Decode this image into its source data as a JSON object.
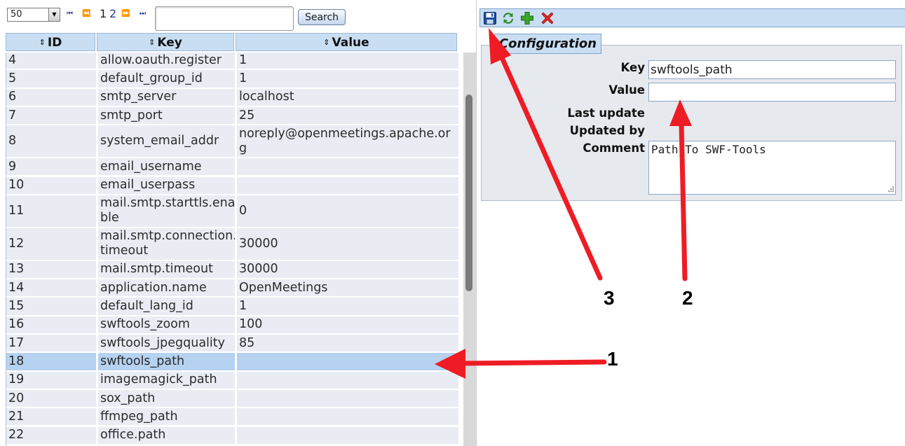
{
  "toolbar": {
    "page_size": "50",
    "nav_first": "⏮",
    "nav_prev": "⏪",
    "pages": [
      "1",
      "2"
    ],
    "nav_next": "⏩",
    "nav_last": "⏭",
    "search_value": "",
    "search_label": "Search"
  },
  "grid": {
    "columns": [
      "ID",
      "Key",
      "Value"
    ],
    "sort_icon": "⇕",
    "rows": [
      {
        "id": "4",
        "key": "allow.oauth.register",
        "value": "1"
      },
      {
        "id": "5",
        "key": "default_group_id",
        "value": "1"
      },
      {
        "id": "6",
        "key": "smtp_server",
        "value": "localhost"
      },
      {
        "id": "7",
        "key": "smtp_port",
        "value": "25"
      },
      {
        "id": "8",
        "key": "system_email_addr",
        "value": "noreply@openmeetings.apache.or\ng"
      },
      {
        "id": "9",
        "key": "email_username",
        "value": ""
      },
      {
        "id": "10",
        "key": "email_userpass",
        "value": ""
      },
      {
        "id": "11",
        "key": "mail.smtp.starttls.ena\nble",
        "value": "0"
      },
      {
        "id": "12",
        "key": "mail.smtp.connection.\ntimeout",
        "value": "30000"
      },
      {
        "id": "13",
        "key": "mail.smtp.timeout",
        "value": "30000"
      },
      {
        "id": "14",
        "key": "application.name",
        "value": "OpenMeetings"
      },
      {
        "id": "15",
        "key": "default_lang_id",
        "value": "1"
      },
      {
        "id": "16",
        "key": "swftools_zoom",
        "value": "100"
      },
      {
        "id": "17",
        "key": "swftools_jpegquality",
        "value": "85"
      },
      {
        "id": "18",
        "key": "swftools_path",
        "value": "",
        "selected": true
      },
      {
        "id": "19",
        "key": "imagemagick_path",
        "value": ""
      },
      {
        "id": "20",
        "key": "sox_path",
        "value": ""
      },
      {
        "id": "21",
        "key": "ffmpeg_path",
        "value": ""
      },
      {
        "id": "22",
        "key": "office.path",
        "value": ""
      }
    ]
  },
  "form": {
    "toolbar_icons": [
      "save-icon",
      "refresh-icon",
      "add-icon",
      "delete-icon"
    ],
    "legend": "Configuration",
    "key_label": "Key",
    "key_value": "swftools_path",
    "value_label": "Value",
    "value_value": "",
    "last_update_label": "Last update",
    "updated_by_label": "Updated by",
    "comment_label": "Comment",
    "comment_value": "Path To SWF-Tools"
  },
  "annotations": {
    "arrow_color": "#ee1c24",
    "labels": [
      "1",
      "2",
      "3"
    ]
  }
}
